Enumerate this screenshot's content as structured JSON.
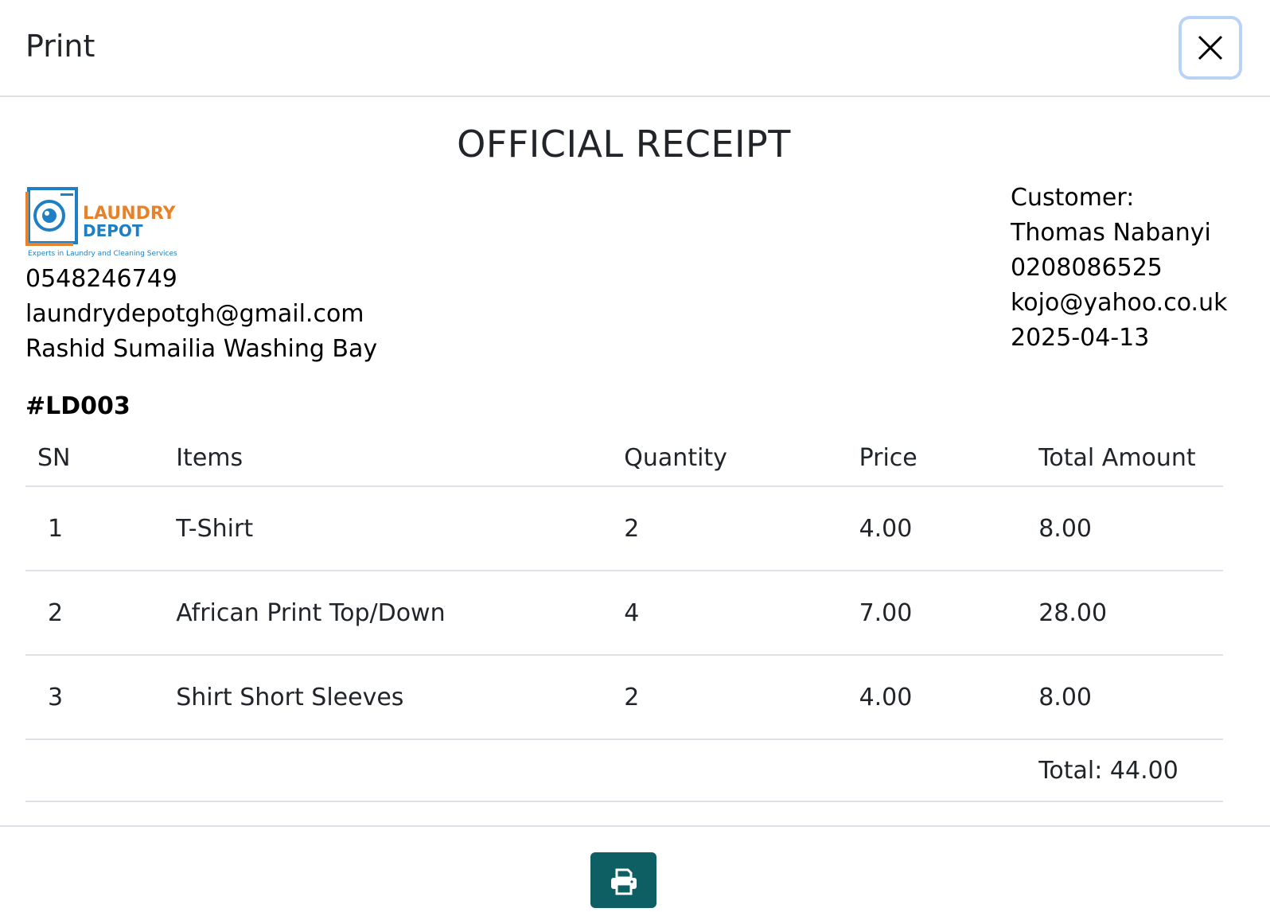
{
  "modal": {
    "title": "Print",
    "close_icon": "close-icon"
  },
  "receipt": {
    "heading": "OFFICIAL RECEIPT",
    "logo": {
      "line1": "LAUNDRY",
      "line2": "DEPOT",
      "tagline": "Experts in Laundry and Cleaning Services",
      "colors": {
        "orange": "#e8822a",
        "blue": "#1f7fc4"
      }
    },
    "company": {
      "phone": "0548246749",
      "email": "laundrydepotgh@gmail.com",
      "address": "Rashid Sumailia Washing Bay"
    },
    "customer": {
      "label": "Customer:",
      "name": "Thomas Nabanyi",
      "phone": "0208086525",
      "email": "kojo@yahoo.co.uk",
      "date": "2025-04-13"
    },
    "invoice_number": "#LD003",
    "table": {
      "headers": [
        "SN",
        "Items",
        "Quantity",
        "Price",
        "Total Amount"
      ],
      "rows": [
        [
          "1",
          "T-Shirt",
          "2",
          "4.00",
          "8.00"
        ],
        [
          "2",
          "African Print Top/Down",
          "4",
          "7.00",
          "28.00"
        ],
        [
          "3",
          "Shirt Short Sleeves",
          "2",
          "4.00",
          "8.00"
        ]
      ],
      "total": "Total: 44.00"
    }
  },
  "footer": {
    "print_icon": "printer-icon",
    "button_color": "#0e5f63"
  }
}
